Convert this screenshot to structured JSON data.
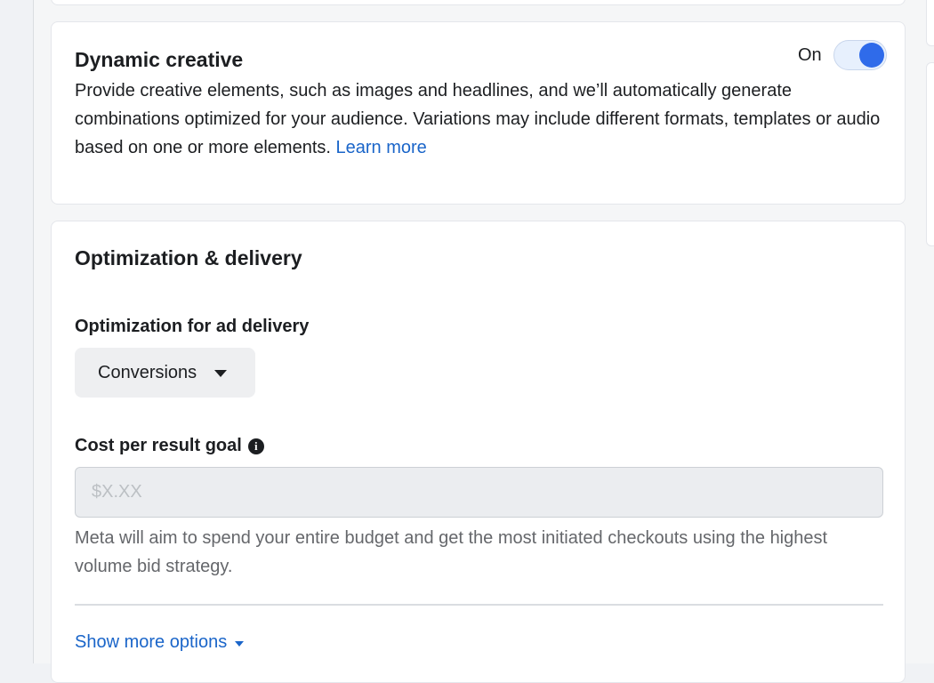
{
  "dynamic_creative": {
    "title": "Dynamic creative",
    "toggle_label": "On",
    "toggle_state": "on",
    "description": "Provide creative elements, such as images and headlines, and we’ll automatically generate combinations optimized for your audience. Variations may include different formats, templates or audio based on one or more elements.",
    "learn_more": "Learn more"
  },
  "optimization": {
    "title": "Optimization & delivery",
    "delivery_label": "Optimization for ad delivery",
    "delivery_value": "Conversions",
    "cost_label": "Cost per result goal",
    "cost_placeholder": "$X.XX",
    "cost_value": "",
    "help_text": "Meta will aim to spend your entire budget and get the most initiated checkouts using the highest volume bid strategy.",
    "show_more": "Show more options"
  },
  "colors": {
    "accent": "#2f6bea",
    "link": "#1a65c9"
  }
}
